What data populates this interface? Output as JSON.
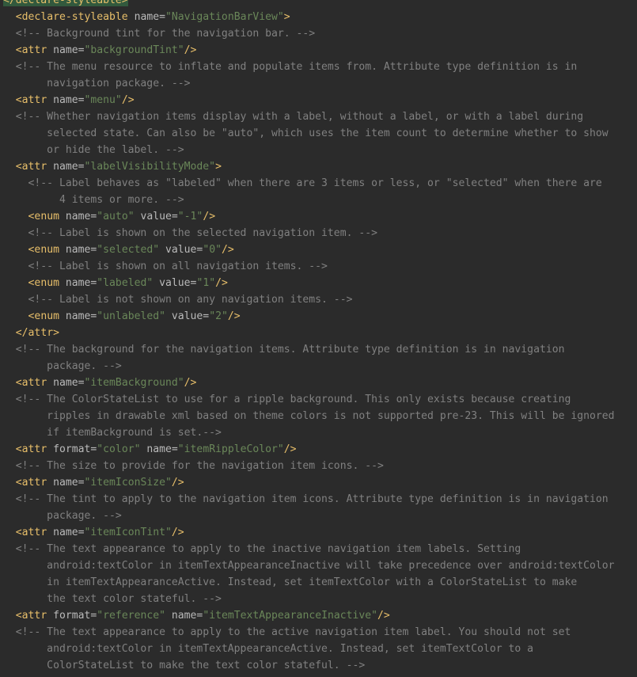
{
  "editor": {
    "language": "xml",
    "colors": {
      "background": "#2b2b2b",
      "tag": "#e8bf6a",
      "attribute": "#bababa",
      "value": "#6a8759",
      "comment": "#808080",
      "highlight": "#32593d"
    },
    "lines": [
      [
        {
          "t": "</declare-styleable>",
          "c": "tag"
        }
      ],
      [
        {
          "t": "  ",
          "c": "plain"
        },
        {
          "t": "<declare-styleable ",
          "c": "tag"
        },
        {
          "t": "name=",
          "c": "attr"
        },
        {
          "t": "\"NavigationBarView\"",
          "c": "val"
        },
        {
          "t": ">",
          "c": "tag"
        }
      ],
      [
        {
          "t": "  <!-- Background tint for the navigation bar. -->",
          "c": "comment"
        }
      ],
      [
        {
          "t": "  ",
          "c": "plain"
        },
        {
          "t": "<attr ",
          "c": "tag"
        },
        {
          "t": "name=",
          "c": "attr"
        },
        {
          "t": "\"backgroundTint\"",
          "c": "val"
        },
        {
          "t": "/>",
          "c": "tag"
        }
      ],
      [
        {
          "t": "  <!-- The menu resource to inflate and populate items from. Attribute type definition is in",
          "c": "comment"
        }
      ],
      [
        {
          "t": "       navigation package. -->",
          "c": "comment"
        }
      ],
      [
        {
          "t": "  ",
          "c": "plain"
        },
        {
          "t": "<attr ",
          "c": "tag"
        },
        {
          "t": "name=",
          "c": "attr"
        },
        {
          "t": "\"menu\"",
          "c": "val"
        },
        {
          "t": "/>",
          "c": "tag"
        }
      ],
      [
        {
          "t": "  <!-- Whether navigation items display with a label, without a label, or with a label during",
          "c": "comment"
        }
      ],
      [
        {
          "t": "       selected state. Can also be \"auto\", which uses the item count to determine whether to show",
          "c": "comment"
        }
      ],
      [
        {
          "t": "       or hide the label. -->",
          "c": "comment"
        }
      ],
      [
        {
          "t": "  ",
          "c": "plain"
        },
        {
          "t": "<attr ",
          "c": "tag"
        },
        {
          "t": "name=",
          "c": "attr"
        },
        {
          "t": "\"labelVisibilityMode\"",
          "c": "val"
        },
        {
          "t": ">",
          "c": "tag"
        }
      ],
      [
        {
          "t": "    <!-- Label behaves as \"labeled\" when there are 3 items or less, or \"selected\" when there are",
          "c": "comment"
        }
      ],
      [
        {
          "t": "         4 items or more. -->",
          "c": "comment"
        }
      ],
      [
        {
          "t": "    ",
          "c": "plain"
        },
        {
          "t": "<enum ",
          "c": "tag"
        },
        {
          "t": "name=",
          "c": "attr"
        },
        {
          "t": "\"auto\" ",
          "c": "val"
        },
        {
          "t": "value=",
          "c": "attr"
        },
        {
          "t": "\"-1\"",
          "c": "val"
        },
        {
          "t": "/>",
          "c": "tag"
        }
      ],
      [
        {
          "t": "    <!-- Label is shown on the selected navigation item. -->",
          "c": "comment"
        }
      ],
      [
        {
          "t": "    ",
          "c": "plain"
        },
        {
          "t": "<enum ",
          "c": "tag"
        },
        {
          "t": "name=",
          "c": "attr"
        },
        {
          "t": "\"selected\" ",
          "c": "val"
        },
        {
          "t": "value=",
          "c": "attr"
        },
        {
          "t": "\"0\"",
          "c": "val"
        },
        {
          "t": "/>",
          "c": "tag"
        }
      ],
      [
        {
          "t": "    <!-- Label is shown on all navigation items. -->",
          "c": "comment"
        }
      ],
      [
        {
          "t": "    ",
          "c": "plain"
        },
        {
          "t": "<enum ",
          "c": "tag"
        },
        {
          "t": "name=",
          "c": "attr"
        },
        {
          "t": "\"labeled\" ",
          "c": "val"
        },
        {
          "t": "value=",
          "c": "attr"
        },
        {
          "t": "\"1\"",
          "c": "val"
        },
        {
          "t": "/>",
          "c": "tag"
        }
      ],
      [
        {
          "t": "    <!-- Label is not shown on any navigation items. -->",
          "c": "comment"
        }
      ],
      [
        {
          "t": "    ",
          "c": "plain"
        },
        {
          "t": "<enum ",
          "c": "tag"
        },
        {
          "t": "name=",
          "c": "attr"
        },
        {
          "t": "\"unlabeled\" ",
          "c": "val"
        },
        {
          "t": "value=",
          "c": "attr"
        },
        {
          "t": "\"2\"",
          "c": "val"
        },
        {
          "t": "/>",
          "c": "tag"
        }
      ],
      [
        {
          "t": "  ",
          "c": "plain"
        },
        {
          "t": "</attr>",
          "c": "tag"
        }
      ],
      [
        {
          "t": "  <!-- The background for the navigation items. Attribute type definition is in navigation",
          "c": "comment"
        }
      ],
      [
        {
          "t": "       package. -->",
          "c": "comment"
        }
      ],
      [
        {
          "t": "  ",
          "c": "plain"
        },
        {
          "t": "<attr ",
          "c": "tag"
        },
        {
          "t": "name=",
          "c": "attr"
        },
        {
          "t": "\"itemBackground\"",
          "c": "val"
        },
        {
          "t": "/>",
          "c": "tag"
        }
      ],
      [
        {
          "t": "  <!-- The ColorStateList to use for a ripple background. This only exists because creating",
          "c": "comment"
        }
      ],
      [
        {
          "t": "       ripples in drawable xml based on theme colors is not supported pre-23. This will be ignored",
          "c": "comment"
        }
      ],
      [
        {
          "t": "       if itemBackground is set.-->",
          "c": "comment"
        }
      ],
      [
        {
          "t": "  ",
          "c": "plain"
        },
        {
          "t": "<attr ",
          "c": "tag"
        },
        {
          "t": "format=",
          "c": "attr"
        },
        {
          "t": "\"color\" ",
          "c": "val"
        },
        {
          "t": "name=",
          "c": "attr"
        },
        {
          "t": "\"itemRippleColor\"",
          "c": "val"
        },
        {
          "t": "/>",
          "c": "tag"
        }
      ],
      [
        {
          "t": "  <!-- The size to provide for the navigation item icons. -->",
          "c": "comment"
        }
      ],
      [
        {
          "t": "  ",
          "c": "plain"
        },
        {
          "t": "<attr ",
          "c": "tag"
        },
        {
          "t": "name=",
          "c": "attr"
        },
        {
          "t": "\"itemIconSize\"",
          "c": "val"
        },
        {
          "t": "/>",
          "c": "tag"
        }
      ],
      [
        {
          "t": "  <!-- The tint to apply to the navigation item icons. Attribute type definition is in navigation",
          "c": "comment"
        }
      ],
      [
        {
          "t": "       package. -->",
          "c": "comment"
        }
      ],
      [
        {
          "t": "  ",
          "c": "plain"
        },
        {
          "t": "<attr ",
          "c": "tag"
        },
        {
          "t": "name=",
          "c": "attr"
        },
        {
          "t": "\"itemIconTint\"",
          "c": "val"
        },
        {
          "t": "/>",
          "c": "tag"
        }
      ],
      [
        {
          "t": "  <!-- The text appearance to apply to the inactive navigation item labels. Setting",
          "c": "comment"
        }
      ],
      [
        {
          "t": "       android:textColor in itemTextAppearanceInactive will take precedence over android:textColor",
          "c": "comment"
        }
      ],
      [
        {
          "t": "       in itemTextAppearanceActive. Instead, set itemTextColor with a ColorStateList to make",
          "c": "comment"
        }
      ],
      [
        {
          "t": "       the text color stateful. -->",
          "c": "comment"
        }
      ],
      [
        {
          "t": "  ",
          "c": "plain"
        },
        {
          "t": "<attr ",
          "c": "tag"
        },
        {
          "t": "format=",
          "c": "attr"
        },
        {
          "t": "\"reference\" ",
          "c": "val"
        },
        {
          "t": "name=",
          "c": "attr"
        },
        {
          "t": "\"itemTextAppearanceInactive\"",
          "c": "val"
        },
        {
          "t": "/>",
          "c": "tag"
        }
      ],
      [
        {
          "t": "  <!-- The text appearance to apply to the active navigation item label. You should not set",
          "c": "comment"
        }
      ],
      [
        {
          "t": "       android:textColor in itemTextAppearanceActive. Instead, set itemTextColor to a",
          "c": "comment"
        }
      ],
      [
        {
          "t": "       ColorStateList to make the text color stateful. -->",
          "c": "comment"
        }
      ]
    ]
  }
}
